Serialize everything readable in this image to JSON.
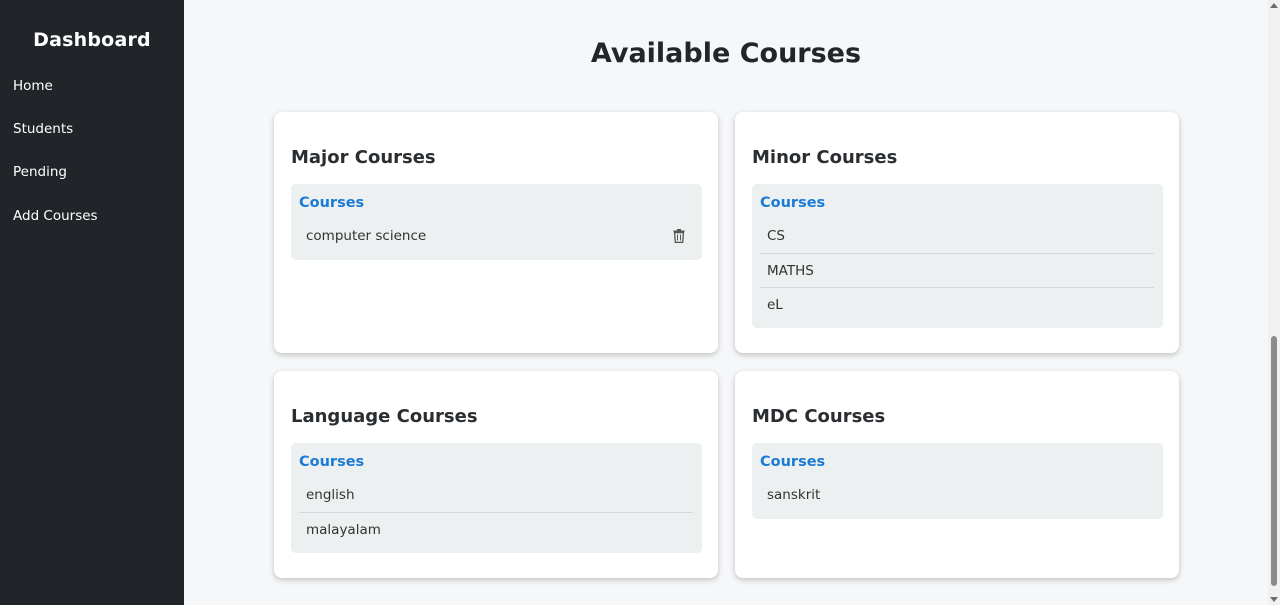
{
  "sidebar": {
    "title": "Dashboard",
    "items": [
      {
        "label": "Home"
      },
      {
        "label": "Students"
      },
      {
        "label": "Pending"
      },
      {
        "label": "Add Courses"
      }
    ]
  },
  "main": {
    "title": "Available Courses",
    "cards": [
      {
        "title": "Major Courses",
        "header": "Courses",
        "courses": [
          "computer science"
        ]
      },
      {
        "title": "Minor Courses",
        "header": "Courses",
        "courses": [
          "CS",
          "MATHS",
          "eL"
        ]
      },
      {
        "title": "Language Courses",
        "header": "Courses",
        "courses": [
          "english",
          "malayalam"
        ]
      },
      {
        "title": "MDC Courses",
        "header": "Courses",
        "courses": [
          "sanskrit"
        ]
      }
    ]
  },
  "colors": {
    "sidebar_bg": "#212529",
    "accent": "#1a7bd6",
    "page_bg": "#f5f7f8",
    "course_box_bg": "#edf0f0"
  }
}
